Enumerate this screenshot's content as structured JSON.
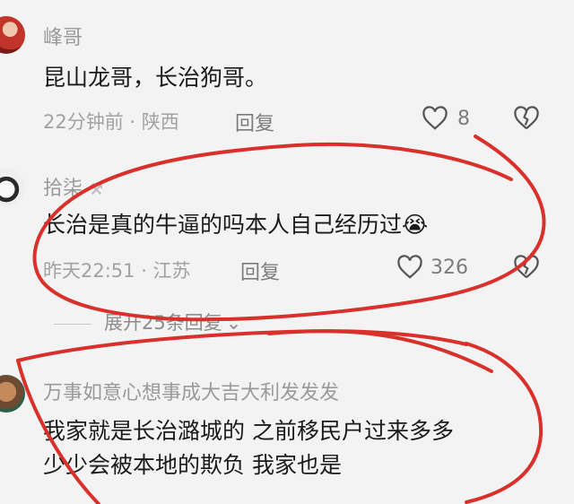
{
  "comments": [
    {
      "username": "峰哥",
      "content": "昆山龙哥，长治狗哥。",
      "time_location": "22分钟前 · 陕西",
      "reply_label": "回复",
      "likes": "8"
    },
    {
      "username": "拾柒",
      "content": "长治是真的牛逼的吗本人自己经历过",
      "emoji": "😭",
      "time_location": "昨天22:51 · 江苏",
      "reply_label": "回复",
      "likes": "326"
    },
    {
      "username": "万事如意心想事成大吉大利发发发",
      "content_lines": [
        "我家就是长治潞城的 之前移民户过来多多",
        "少少会被本地的欺负 我家也是"
      ]
    }
  ],
  "expand_replies": "展开25条回复",
  "colors": {
    "annotation": "#d9302b",
    "muted": "#a2a2a2",
    "background": "#f3f3f3"
  }
}
